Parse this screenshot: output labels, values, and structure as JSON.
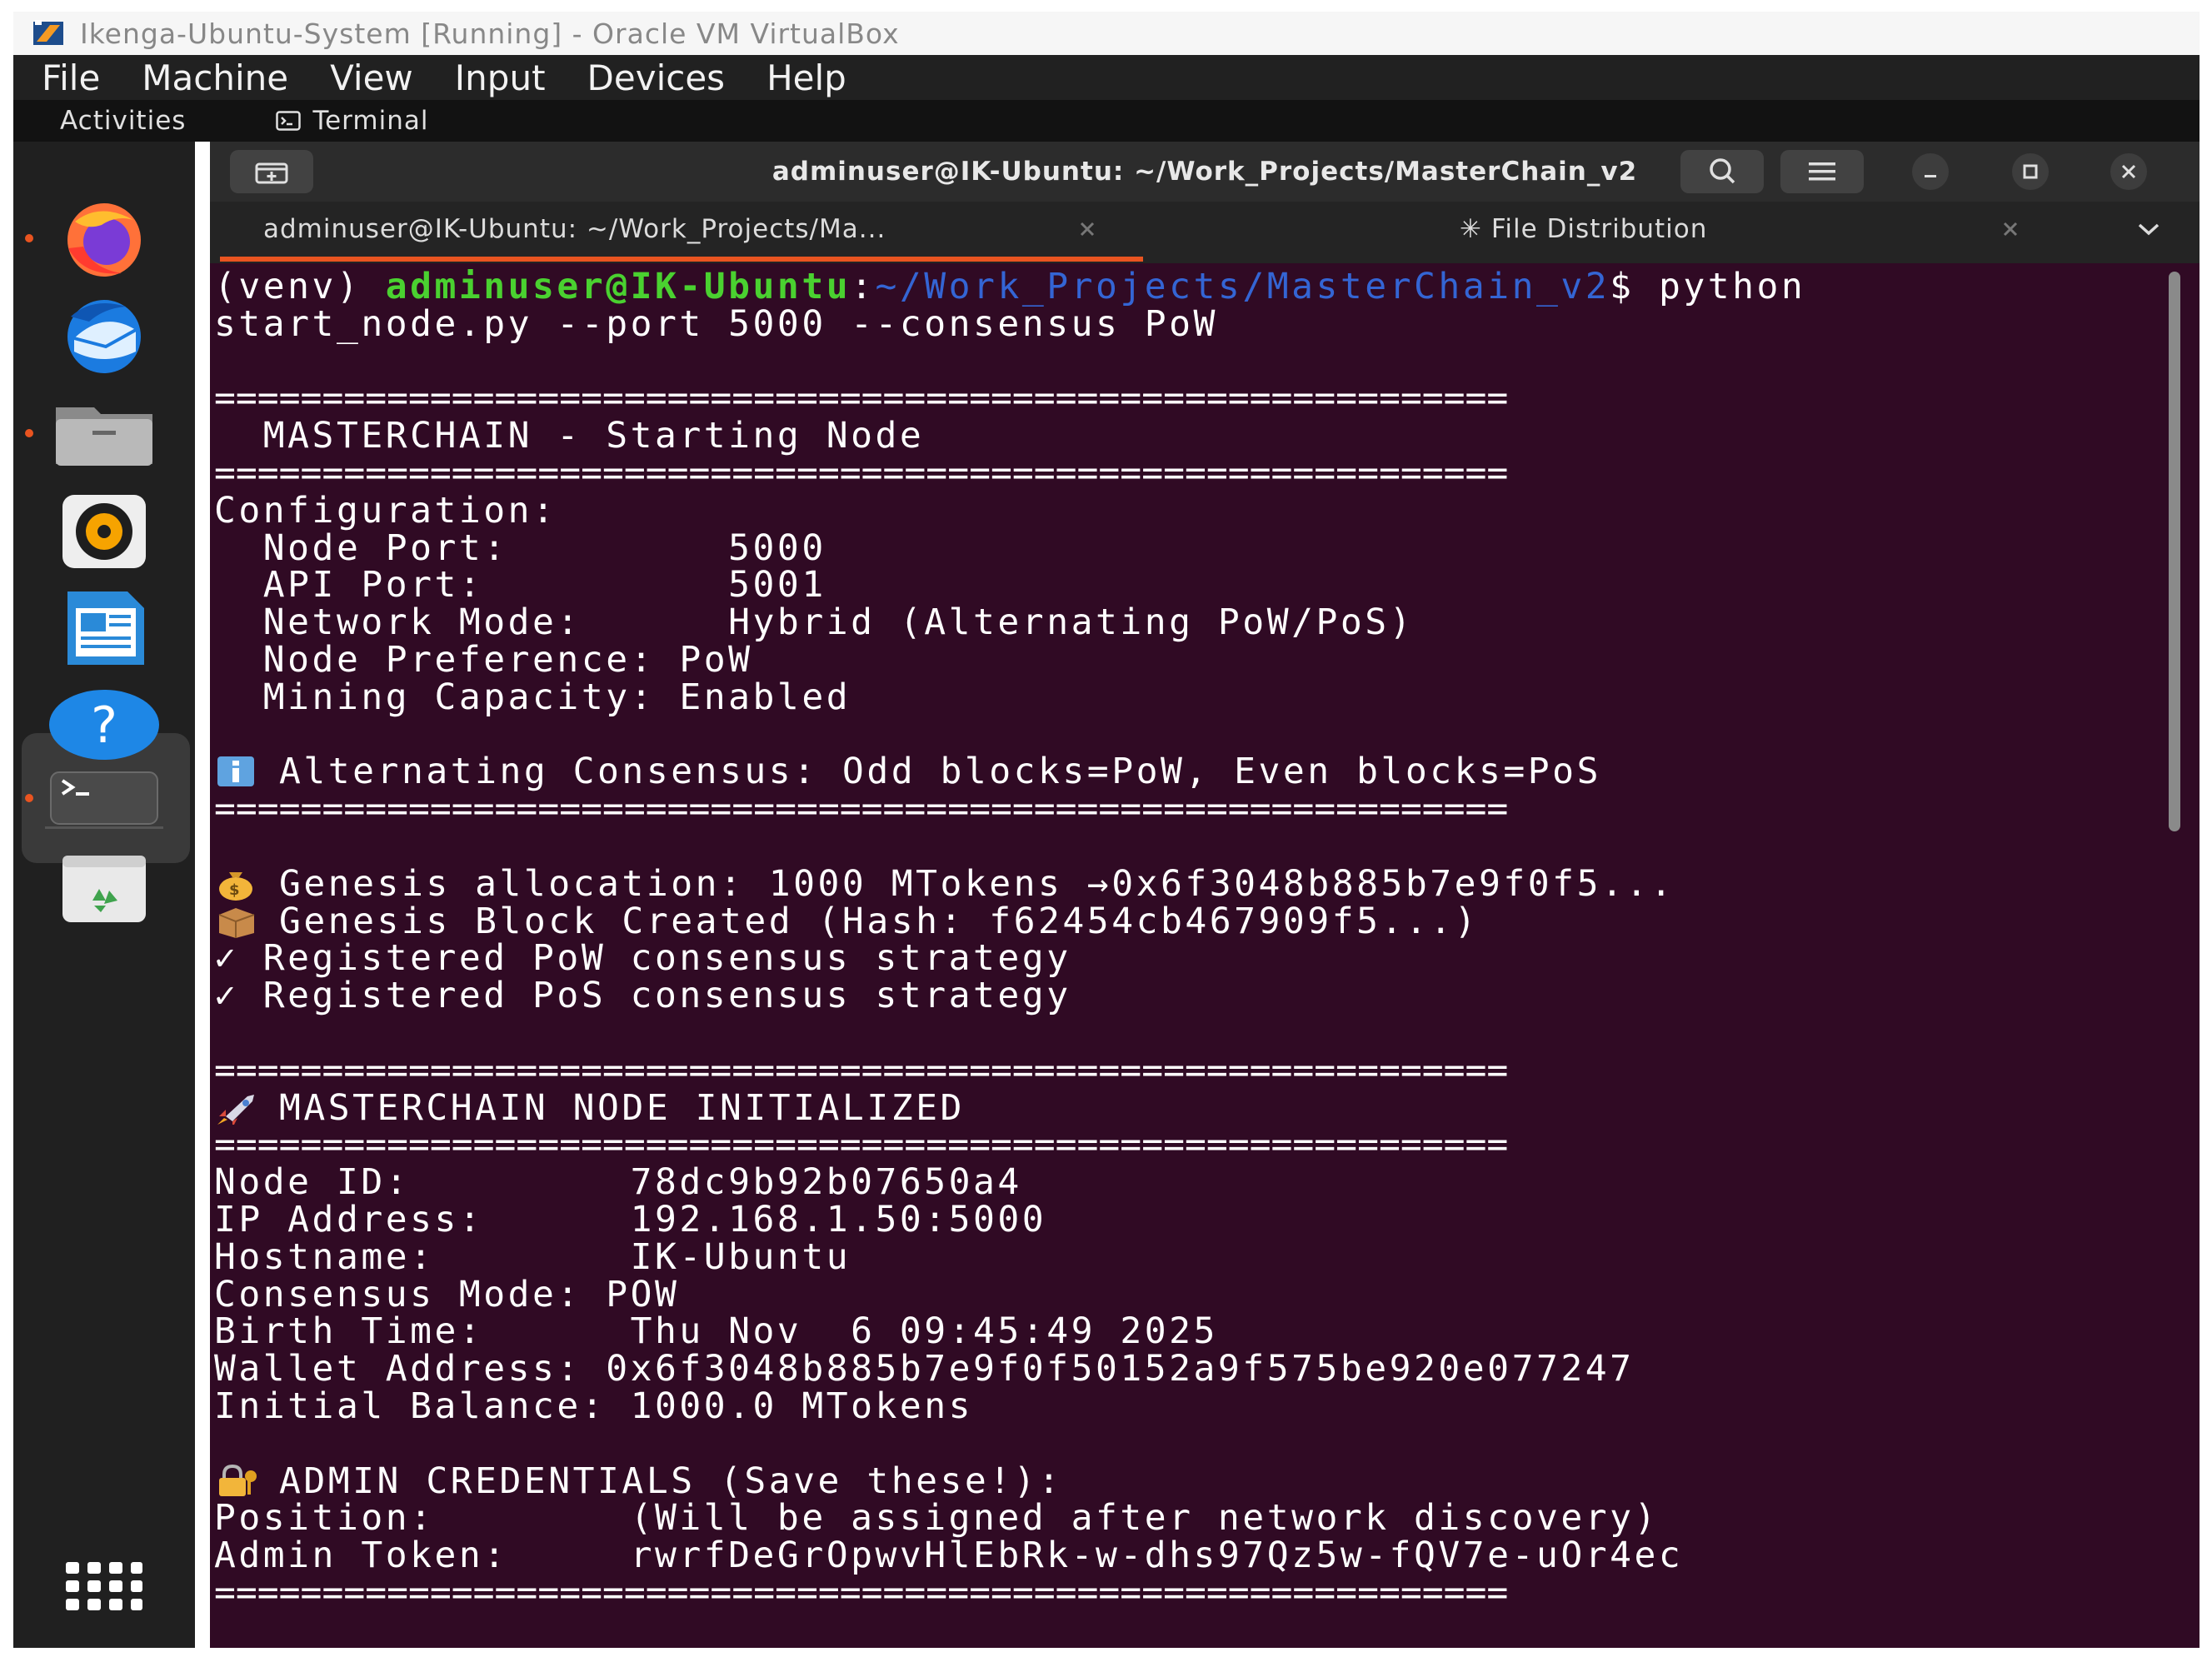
{
  "vbox": {
    "title": "Ikenga-Ubuntu-System [Running] - Oracle VM VirtualBox",
    "menu": [
      "File",
      "Machine",
      "View",
      "Input",
      "Devices",
      "Help"
    ]
  },
  "topbar": {
    "activities": "Activities",
    "app_menu": "Terminal"
  },
  "dock": {
    "items": [
      "firefox-icon",
      "thunderbird-icon",
      "files-icon",
      "rhythmbox-icon",
      "writer-icon",
      "help-icon",
      "terminal-icon",
      "trash-icon",
      "app-grid-icon"
    ]
  },
  "terminal": {
    "title": "adminuser@IK-Ubuntu: ~/Work_Projects/MasterChain_v2",
    "tabs": [
      {
        "label": "adminuser@IK-Ubuntu: ~/Work_Projects/Ma..."
      },
      {
        "label": "✳ File Distribution"
      }
    ],
    "prompt": {
      "venv": "(venv) ",
      "user": "adminuser@IK-Ubuntu",
      "colon": ":",
      "path": "~/Work_Projects/MasterChain_v2",
      "dollar": "$ ",
      "command": "python",
      "command_cont": "start_node.py --port 5000 --consensus PoW"
    },
    "sep": "============================================================",
    "header1": "  MASTERCHAIN - Starting Node",
    "config_title": "Configuration:",
    "config": [
      "  Node Port:         5000",
      "  API Port:          5001",
      "  Network Mode:      Hybrid (Alternating PoW/PoS)",
      "  Node Preference: PoW",
      "  Mining Capacity: Enabled"
    ],
    "info_line": "Alternating Consensus: Odd blocks=PoW, Even blocks=PoS",
    "genesis_alloc": "Genesis allocation: 1000 MTokens →0x6f3048b885b7e9f0f5...",
    "genesis_block": "Genesis Block Created (Hash: f62454cb467909f5...)",
    "registered": [
      "✓ Registered PoW consensus strategy",
      "✓ Registered PoS consensus strategy"
    ],
    "header2": "MASTERCHAIN NODE INITIALIZED",
    "node_info": [
      "Node ID:         78dc9b92b07650a4",
      "IP Address:      192.168.1.50:5000",
      "Hostname:        IK-Ubuntu",
      "Consensus Mode: POW",
      "Birth Time:      Thu Nov  6 09:45:49 2025",
      "Wallet Address: 0x6f3048b885b7e9f0f50152a9f575be920e077247",
      "Initial Balance: 1000.0 MTokens"
    ],
    "admin_title": "ADMIN CREDENTIALS (Save these!):",
    "admin": [
      "Position:        (Will be assigned after network discovery)",
      "Admin Token:     rwrfDeGrOpwvHlEbRk-w-dhs97Qz5w-fQV7e-uOr4ec"
    ]
  },
  "colors": {
    "terminal_bg": "#300a24",
    "prompt_user": "#4ad130",
    "prompt_path": "#3465d4",
    "accent": "#e95420"
  }
}
